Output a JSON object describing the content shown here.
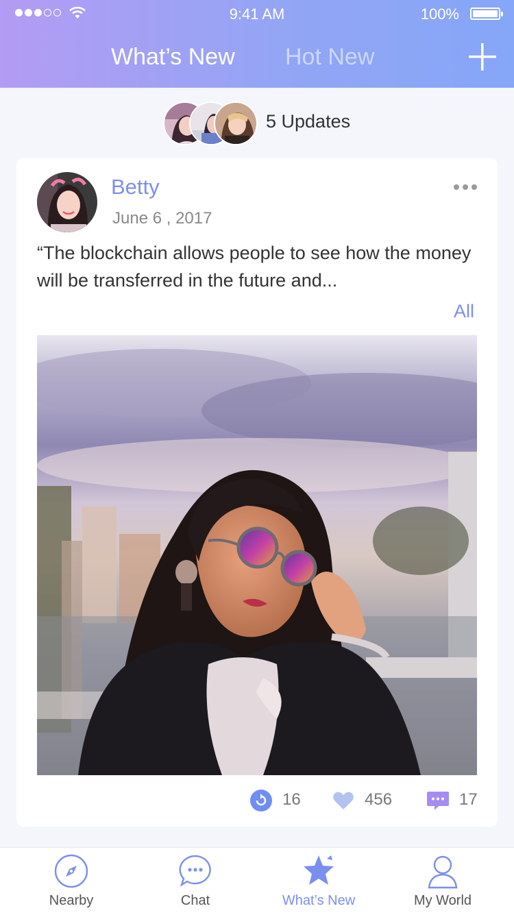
{
  "status_bar": {
    "time": "9:41 AM",
    "battery": "100%"
  },
  "header": {
    "tabs": [
      {
        "label": "What’s New",
        "active": true
      },
      {
        "label": "Hot New",
        "active": false
      }
    ],
    "add_icon": "plus-icon"
  },
  "updates": {
    "text": "5 Updates"
  },
  "post": {
    "author": "Betty",
    "date": "June 6 , 2017",
    "text": "“The blockchain allows people to see how the money will be transferred in the future and...",
    "more_link": "All",
    "stats": {
      "reposts": "16",
      "likes": "456",
      "comments": "17"
    }
  },
  "bottom_nav": [
    {
      "label": "Nearby",
      "icon": "compass-icon",
      "active": false
    },
    {
      "label": "Chat",
      "icon": "chat-icon",
      "active": false
    },
    {
      "label": "What’s New",
      "icon": "star-icon",
      "active": true
    },
    {
      "label": "My World",
      "icon": "person-icon",
      "active": false
    }
  ],
  "colors": {
    "accent": "#7b8ff0",
    "header_start": "#b39cf3",
    "header_end": "#86a6f7"
  }
}
